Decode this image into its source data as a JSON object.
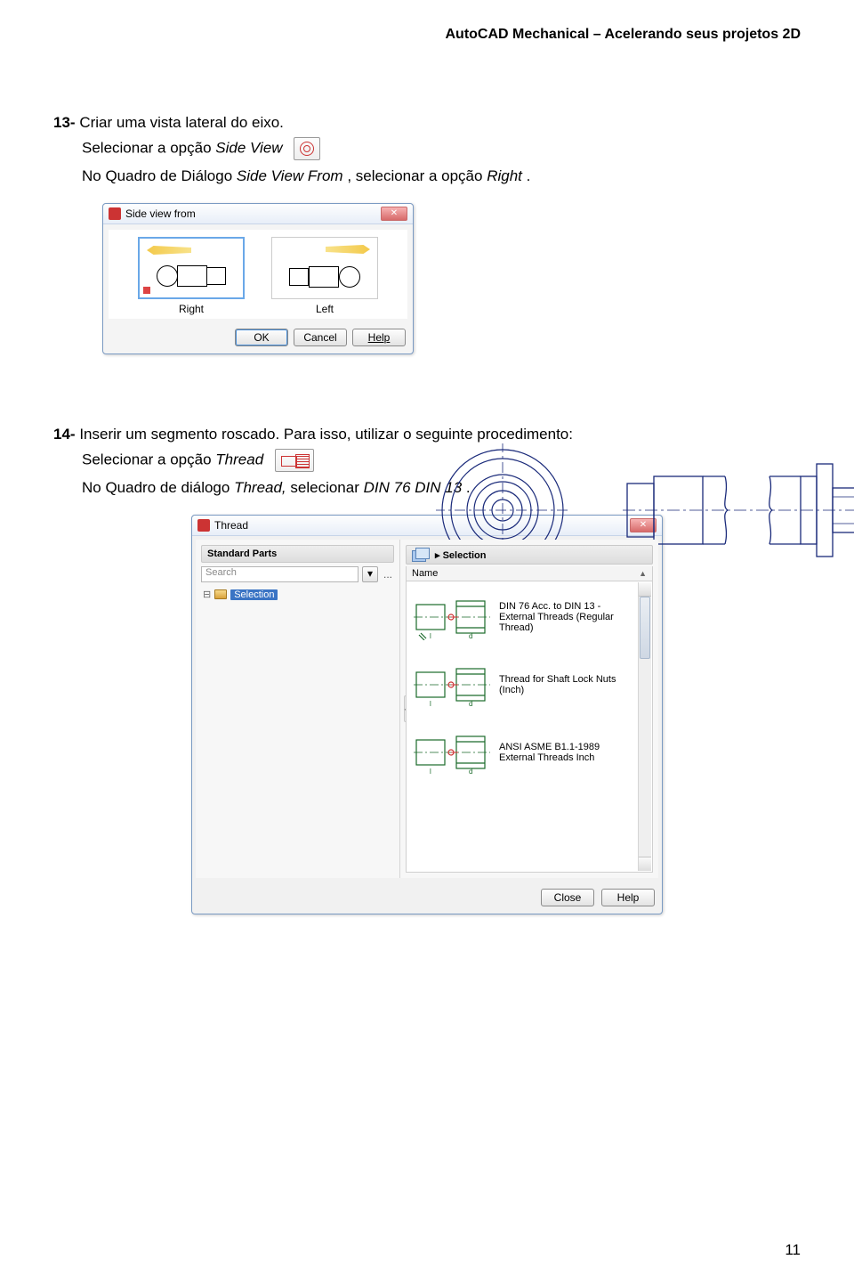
{
  "header": "AutoCAD Mechanical – Acelerando seus projetos 2D",
  "step13": {
    "num": "13-",
    "title": "Criar uma vista lateral do eixo.",
    "line1a": "Selecionar a opção ",
    "line1b": "Side View",
    "line2a": "No Quadro de Diálogo ",
    "line2b": "Side View From",
    "line2c": ", selecionar a opção ",
    "line2d": "Right",
    "line2e": "."
  },
  "svf": {
    "title": "Side view from",
    "right": "Right",
    "left": "Left",
    "ok": "OK",
    "cancel": "Cancel",
    "help": "Help",
    "close_x": "✕"
  },
  "step14": {
    "num": "14-",
    "title": "Inserir um segmento roscado. Para isso, utilizar o seguinte procedimento:",
    "line1a": "Selecionar a opção ",
    "line1b": "Thread",
    "line2a": "No Quadro de diálogo ",
    "line2b": "Thread,",
    "line2c": " selecionar ",
    "line2d": "DIN 76 DIN 13",
    "line2e": "."
  },
  "thread": {
    "title": "Thread",
    "std_parts": "Standard Parts",
    "search_ph": "Search",
    "dots": "...",
    "tree_sel": "Selection",
    "details": "Details",
    "selection_arrow": "▸  Selection",
    "name": "Name",
    "items": [
      "DIN 76 Acc. to DIN 13 - External Threads (Regular Thread)",
      "Thread for Shaft Lock Nuts (Inch)",
      "ANSI ASME B1.1-1989 External Threads Inch"
    ],
    "close": "Close",
    "help": "Help",
    "close_x": "✕"
  },
  "page_num": "11"
}
